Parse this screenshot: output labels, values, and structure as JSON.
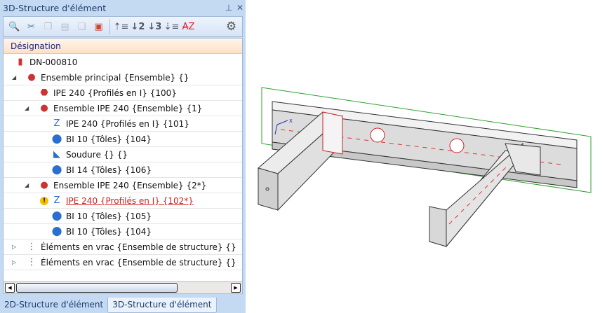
{
  "panel": {
    "title": "3D-Structure d'élément",
    "pin_icon": "pin-icon",
    "close_icon": "close-icon"
  },
  "toolbar": {
    "icons": [
      "find-icon",
      "cut-icon",
      "copy-icon",
      "paste-icon",
      "copy-special-icon",
      "paste-special-icon",
      "expand-level-1-icon",
      "expand-level-2-icon",
      "expand-level-3-icon",
      "expand-all-icon",
      "clear-sort-icon",
      "settings-icon"
    ]
  },
  "tree": {
    "header": "Désignation",
    "items": [
      {
        "label": "DN-000810",
        "level": 0,
        "expander": "",
        "icon": "drawing-icon"
      },
      {
        "label": "Ensemble principal {Ensemble} {}",
        "level": 1,
        "expander": "expanded",
        "icon": "assembly-icon"
      },
      {
        "label": "IPE 240 {Profilés en I} {100}",
        "level": 2,
        "expander": "",
        "icon": "beam-icon"
      },
      {
        "label": "Ensemble IPE 240 {Ensemble} {1}",
        "level": 2,
        "expander": "expanded",
        "icon": "assembly-icon"
      },
      {
        "label": "IPE 240 {Profilés en I} {101}",
        "level": 3,
        "expander": "",
        "icon": "beam-main-icon"
      },
      {
        "label": "BI 10 {Tôles} {104}",
        "level": 3,
        "expander": "",
        "icon": "plate-icon"
      },
      {
        "label": "Soudure {} {}",
        "level": 3,
        "expander": "",
        "icon": "weld-icon"
      },
      {
        "label": "BI 14 {Tôles} {106}",
        "level": 3,
        "expander": "",
        "icon": "plate-icon"
      },
      {
        "label": "Ensemble IPE 240 {Ensemble} {2*}",
        "level": 2,
        "expander": "expanded",
        "icon": "assembly-icon"
      },
      {
        "label": "IPE 240 {Profilés en I} {102*}",
        "level": 3,
        "expander": "",
        "icon": "beam-main-icon",
        "warning": true
      },
      {
        "label": "BI 10 {Tôles} {105}",
        "level": 3,
        "expander": "",
        "icon": "plate-icon"
      },
      {
        "label": "BI 10 {Tôles} {104}",
        "level": 3,
        "expander": "",
        "icon": "plate-icon"
      },
      {
        "label": "Éléments en vrac {Ensemble de structure} {}",
        "level": 1,
        "expander": "collapsed",
        "icon": "loose-parts-icon"
      },
      {
        "label": "Éléments en vrac {Ensemble de structure} {}",
        "level": 1,
        "expander": "collapsed",
        "icon": "loose-parts-icon"
      }
    ]
  },
  "tabs": [
    "2D-Structure d'élément",
    "3D-Structure d'élément"
  ],
  "active_tab": 1,
  "colors": {
    "panel_bg": "#c4daf3",
    "header_bg": "#fde1c4",
    "warning_text": "#d32020",
    "frame_green": "#2ea02e"
  }
}
